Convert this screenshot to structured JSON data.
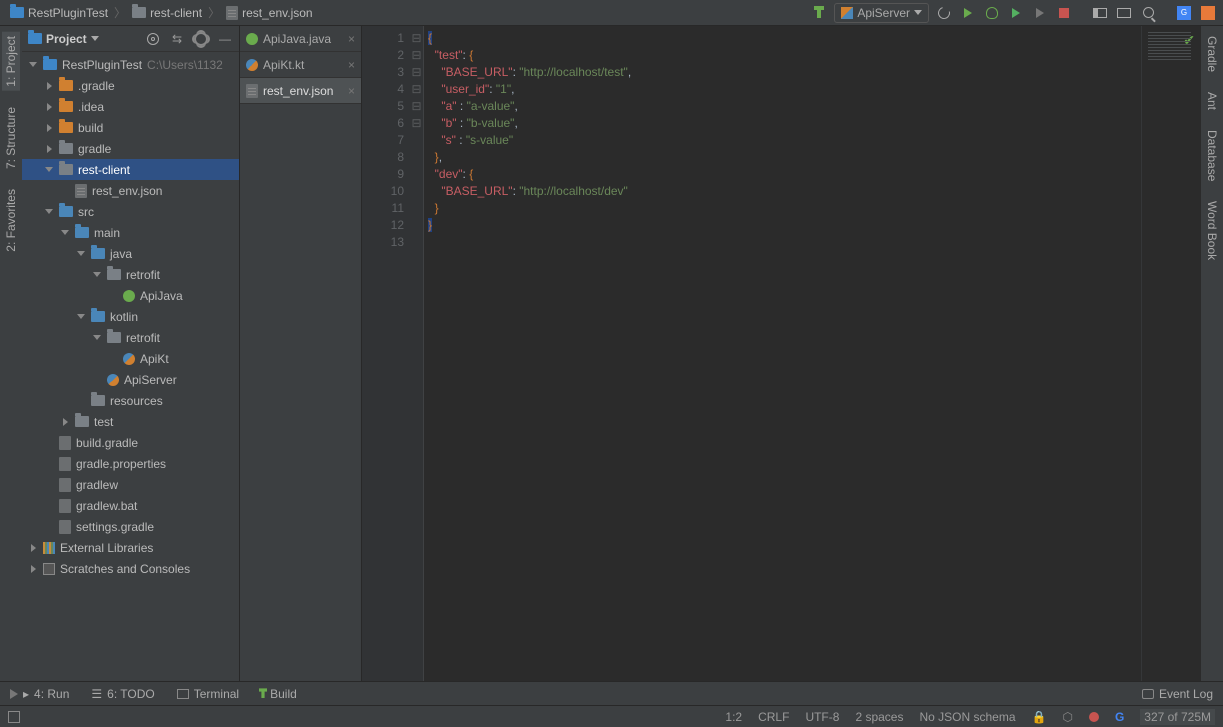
{
  "breadcrumb": [
    {
      "icon": "project",
      "label": "RestPluginTest"
    },
    {
      "icon": "folder",
      "label": "rest-client"
    },
    {
      "icon": "file-json",
      "label": "rest_env.json"
    }
  ],
  "run_config": {
    "label": "ApiServer"
  },
  "project": {
    "header": "Project",
    "root": "RestPluginTest",
    "root_path": "C:\\Users\\1132",
    "tree": [
      {
        "indent": 0,
        "exp": "dn",
        "icon": "project",
        "label": "RestPluginTest",
        "tail": "C:\\Users\\1132"
      },
      {
        "indent": 1,
        "exp": "rt",
        "icon": "folder orange",
        "label": ".gradle"
      },
      {
        "indent": 1,
        "exp": "rt",
        "icon": "folder orange",
        "label": ".idea"
      },
      {
        "indent": 1,
        "exp": "rt",
        "icon": "folder orange",
        "label": "build"
      },
      {
        "indent": 1,
        "exp": "rt",
        "icon": "folder grey",
        "label": "gradle"
      },
      {
        "indent": 1,
        "exp": "dn",
        "icon": "folder grey",
        "label": "rest-client",
        "selected": true
      },
      {
        "indent": 2,
        "exp": "",
        "icon": "file-json",
        "label": "rest_env.json"
      },
      {
        "indent": 1,
        "exp": "dn",
        "icon": "folder blue",
        "label": "src"
      },
      {
        "indent": 2,
        "exp": "dn",
        "icon": "folder blue",
        "label": "main"
      },
      {
        "indent": 3,
        "exp": "dn",
        "icon": "folder blue",
        "label": "java"
      },
      {
        "indent": 4,
        "exp": "dn",
        "icon": "folder grey",
        "label": "retrofit"
      },
      {
        "indent": 5,
        "exp": "",
        "icon": "dot-green",
        "label": "ApiJava"
      },
      {
        "indent": 3,
        "exp": "dn",
        "icon": "folder blue",
        "label": "kotlin"
      },
      {
        "indent": 4,
        "exp": "dn",
        "icon": "folder grey",
        "label": "retrofit"
      },
      {
        "indent": 5,
        "exp": "",
        "icon": "dot-kt",
        "label": "ApiKt"
      },
      {
        "indent": 4,
        "exp": "",
        "icon": "dot-kt",
        "label": "ApiServer"
      },
      {
        "indent": 3,
        "exp": "",
        "icon": "folder grey",
        "label": "resources"
      },
      {
        "indent": 2,
        "exp": "rt",
        "icon": "folder grey",
        "label": "test"
      },
      {
        "indent": 1,
        "exp": "",
        "icon": "file",
        "label": "build.gradle"
      },
      {
        "indent": 1,
        "exp": "",
        "icon": "file",
        "label": "gradle.properties"
      },
      {
        "indent": 1,
        "exp": "",
        "icon": "file",
        "label": "gradlew"
      },
      {
        "indent": 1,
        "exp": "",
        "icon": "file",
        "label": "gradlew.bat"
      },
      {
        "indent": 1,
        "exp": "",
        "icon": "file",
        "label": "settings.gradle"
      },
      {
        "indent": 0,
        "exp": "rt",
        "icon": "lib",
        "label": "External Libraries"
      },
      {
        "indent": 0,
        "exp": "rt",
        "icon": "scratch",
        "label": "Scratches and Consoles"
      }
    ]
  },
  "left_tabs": [
    {
      "label": "1: Project",
      "active": true
    },
    {
      "label": "7: Structure"
    },
    {
      "label": "2: Favorites"
    }
  ],
  "right_tabs": [
    {
      "label": "Gradle"
    },
    {
      "label": "Ant"
    },
    {
      "label": "Database"
    },
    {
      "label": "Word Book"
    }
  ],
  "editor_tabs": [
    {
      "label": "ApiJava.java",
      "icon": "dot-green"
    },
    {
      "label": "ApiKt.kt",
      "icon": "dot-kt"
    },
    {
      "label": "rest_env.json",
      "icon": "file-json",
      "active": true
    }
  ],
  "code_lines": [
    {
      "n": 1,
      "tokens": [
        [
          "punc",
          "{",
          "hl"
        ]
      ]
    },
    {
      "n": 2,
      "indent": "  ",
      "tokens": [
        [
          "key",
          "\"test\""
        ],
        [
          "pl",
          ": "
        ],
        [
          "punc",
          "{"
        ]
      ]
    },
    {
      "n": 3,
      "indent": "    ",
      "tokens": [
        [
          "key",
          "\"BASE_URL\""
        ],
        [
          "pl",
          ": "
        ],
        [
          "str",
          "\"http://localhost/test\""
        ],
        [
          "pl",
          ","
        ]
      ]
    },
    {
      "n": 4,
      "indent": "    ",
      "tokens": [
        [
          "key",
          "\"user_id\""
        ],
        [
          "pl",
          ": "
        ],
        [
          "str",
          "\"1\""
        ],
        [
          "pl",
          ","
        ]
      ]
    },
    {
      "n": 5,
      "indent": "    ",
      "tokens": [
        [
          "key",
          "\"a\""
        ],
        [
          "pl",
          " : "
        ],
        [
          "str",
          "\"a-value\""
        ],
        [
          "pl",
          ","
        ]
      ]
    },
    {
      "n": 6,
      "indent": "    ",
      "tokens": [
        [
          "key",
          "\"b\""
        ],
        [
          "pl",
          " : "
        ],
        [
          "str",
          "\"b-value\""
        ],
        [
          "pl",
          ","
        ]
      ]
    },
    {
      "n": 7,
      "indent": "    ",
      "tokens": [
        [
          "key",
          "\"s\""
        ],
        [
          "pl",
          " : "
        ],
        [
          "str",
          "\"s-value\""
        ]
      ]
    },
    {
      "n": 8,
      "indent": "  ",
      "tokens": [
        [
          "punc",
          "}"
        ],
        [
          "pl",
          ","
        ]
      ]
    },
    {
      "n": 9,
      "indent": "  ",
      "tokens": [
        [
          "key",
          "\"dev\""
        ],
        [
          "pl",
          ": "
        ],
        [
          "punc",
          "{"
        ]
      ]
    },
    {
      "n": 10,
      "indent": "    ",
      "tokens": [
        [
          "key",
          "\"BASE_URL\""
        ],
        [
          "pl",
          ": "
        ],
        [
          "str",
          "\"http://localhost/dev\""
        ]
      ]
    },
    {
      "n": 11,
      "indent": "  ",
      "tokens": [
        [
          "punc",
          "}"
        ]
      ]
    },
    {
      "n": 12,
      "tokens": [
        [
          "punc",
          "}",
          "hl"
        ]
      ]
    },
    {
      "n": 13,
      "tokens": []
    }
  ],
  "fold_marks": {
    "1": "⊟",
    "2": "⊟",
    "8": "⊟",
    "9": "⊟",
    "11": "⊟",
    "12": "⊟"
  },
  "footer": {
    "run": "4: Run",
    "todo": "6: TODO",
    "terminal": "Terminal",
    "build": "Build",
    "eventlog": "Event Log"
  },
  "status": {
    "pos": "1:2",
    "line_sep": "CRLF",
    "encoding": "UTF-8",
    "indent": "2 spaces",
    "schema": "No JSON schema",
    "mem": "327 of 725M"
  }
}
